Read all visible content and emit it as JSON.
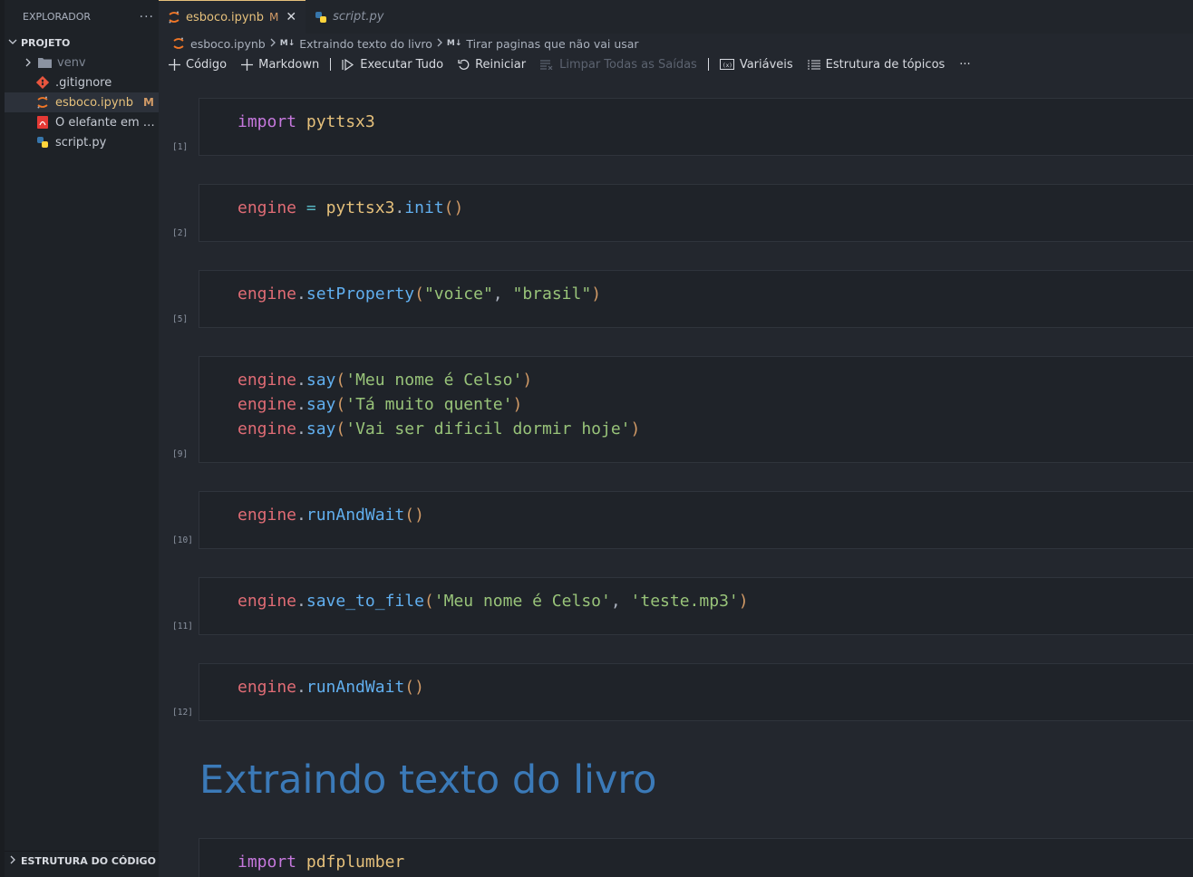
{
  "sidebar": {
    "title": "EXPLORADOR",
    "more": "···",
    "project_label": "PROJETO",
    "items": [
      {
        "label": "venv",
        "icon": "folder-icon"
      },
      {
        "label": ".gitignore",
        "icon": "git-icon"
      },
      {
        "label": "esboco.ipynb",
        "icon": "jupyter-icon",
        "badge": "M"
      },
      {
        "label": "O elefante em ap...",
        "icon": "pdf-icon"
      },
      {
        "label": "script.py",
        "icon": "python-icon"
      }
    ],
    "outline_label": "ESTRUTURA DO CÓDIGO"
  },
  "tabs": [
    {
      "label": "esboco.ipynb",
      "badge": "M",
      "close": "✕"
    },
    {
      "label": "script.py"
    }
  ],
  "breadcrumb": {
    "file": "esboco.ipynb",
    "md_mark": "M↓",
    "section1": "Extraindo texto do livro",
    "section2": "Tirar paginas que não vai usar"
  },
  "toolbar": {
    "code": "Código",
    "markdown": "Markdown",
    "run_all": "Executar Tudo",
    "restart": "Reiniciar",
    "clear_outputs": "Limpar Todas as Saídas",
    "variables": "Variáveis",
    "outline": "Estrutura de tópicos",
    "more": "···"
  },
  "cells": [
    {
      "count": "[1]",
      "lines": [
        "import pyttsx3"
      ]
    },
    {
      "count": "[2]",
      "lines": [
        "engine = pyttsx3.init()"
      ]
    },
    {
      "count": "[5]",
      "lines": [
        "engine.setProperty(\"voice\", \"brasil\")"
      ]
    },
    {
      "count": "[9]",
      "lines": [
        "engine.say('Meu nome é Celso')",
        "engine.say('Tá muito quente')",
        "engine.say('Vai ser dificil dormir hoje')"
      ]
    },
    {
      "count": "[10]",
      "lines": [
        "engine.runAndWait()"
      ]
    },
    {
      "count": "[11]",
      "lines": [
        "engine.save_to_file('Meu nome é Celso', 'teste.mp3')"
      ]
    },
    {
      "count": "[12]",
      "lines": [
        "engine.runAndWait()"
      ]
    },
    {
      "count": "",
      "lines": [
        "import pdfplumber"
      ]
    }
  ],
  "markdown_heading": "Extraindo texto do livro",
  "colors": {
    "accent": "#e5c07b",
    "heading": "#3b7ab8",
    "keyword": "#c678dd",
    "variable": "#e06c75",
    "function": "#61afef",
    "string": "#98c379"
  }
}
